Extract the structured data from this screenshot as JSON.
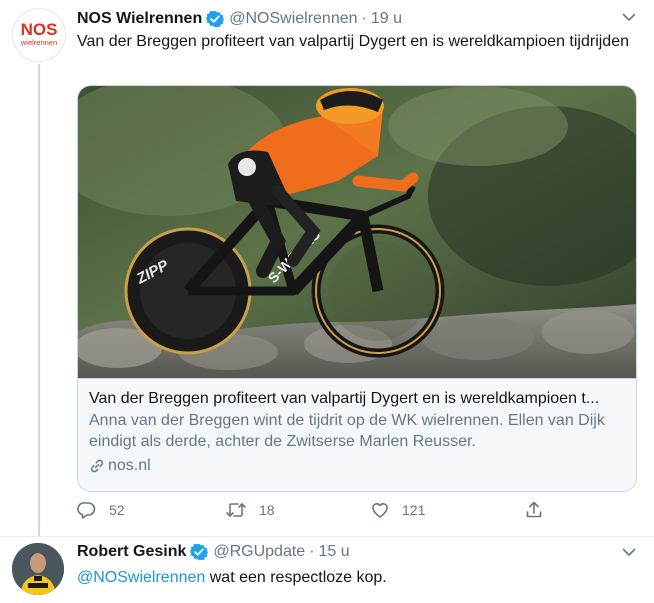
{
  "tweet1": {
    "display_name": "NOS Wielrennen",
    "handle": "@NOSwielrennen",
    "separator": "·",
    "time": "19 u",
    "text": "Van der Breggen profiteert van valpartij Dygert en is wereldkampioen tijdrijden",
    "avatar": {
      "logo_text": "NOS",
      "sub_text": "wielrennen",
      "logo_color": "#e0301e"
    },
    "card": {
      "title": "Van der Breggen profiteert van valpartij Dygert en is wereldkampioen t...",
      "description": "Anna van der Breggen wint de tijdrit op de WK wielrennen. Ellen van Dijk eindigt als derde, achter de Zwitserse Marlen Reusser.",
      "domain": "nos.nl",
      "image_text": {
        "bike_brand": "S-WORKS",
        "wheel_brand": "ZIPP"
      }
    },
    "actions": {
      "replies": "52",
      "retweets": "18",
      "likes": "121"
    }
  },
  "tweet2": {
    "display_name": "Robert Gesink",
    "handle": "@RGUpdate",
    "separator": "·",
    "time": "15 u",
    "mention": "@NOSwielrennen",
    "text": " wat een respectloze kop."
  },
  "colors": {
    "accent": "#1b95e0",
    "verified": "#1da1f2",
    "secondary_text": "#657786",
    "border": "#ccd6dd"
  },
  "icons": [
    "verified-badge-icon",
    "chevron-down-icon",
    "link-icon",
    "reply-icon",
    "retweet-icon",
    "like-icon",
    "share-icon"
  ]
}
